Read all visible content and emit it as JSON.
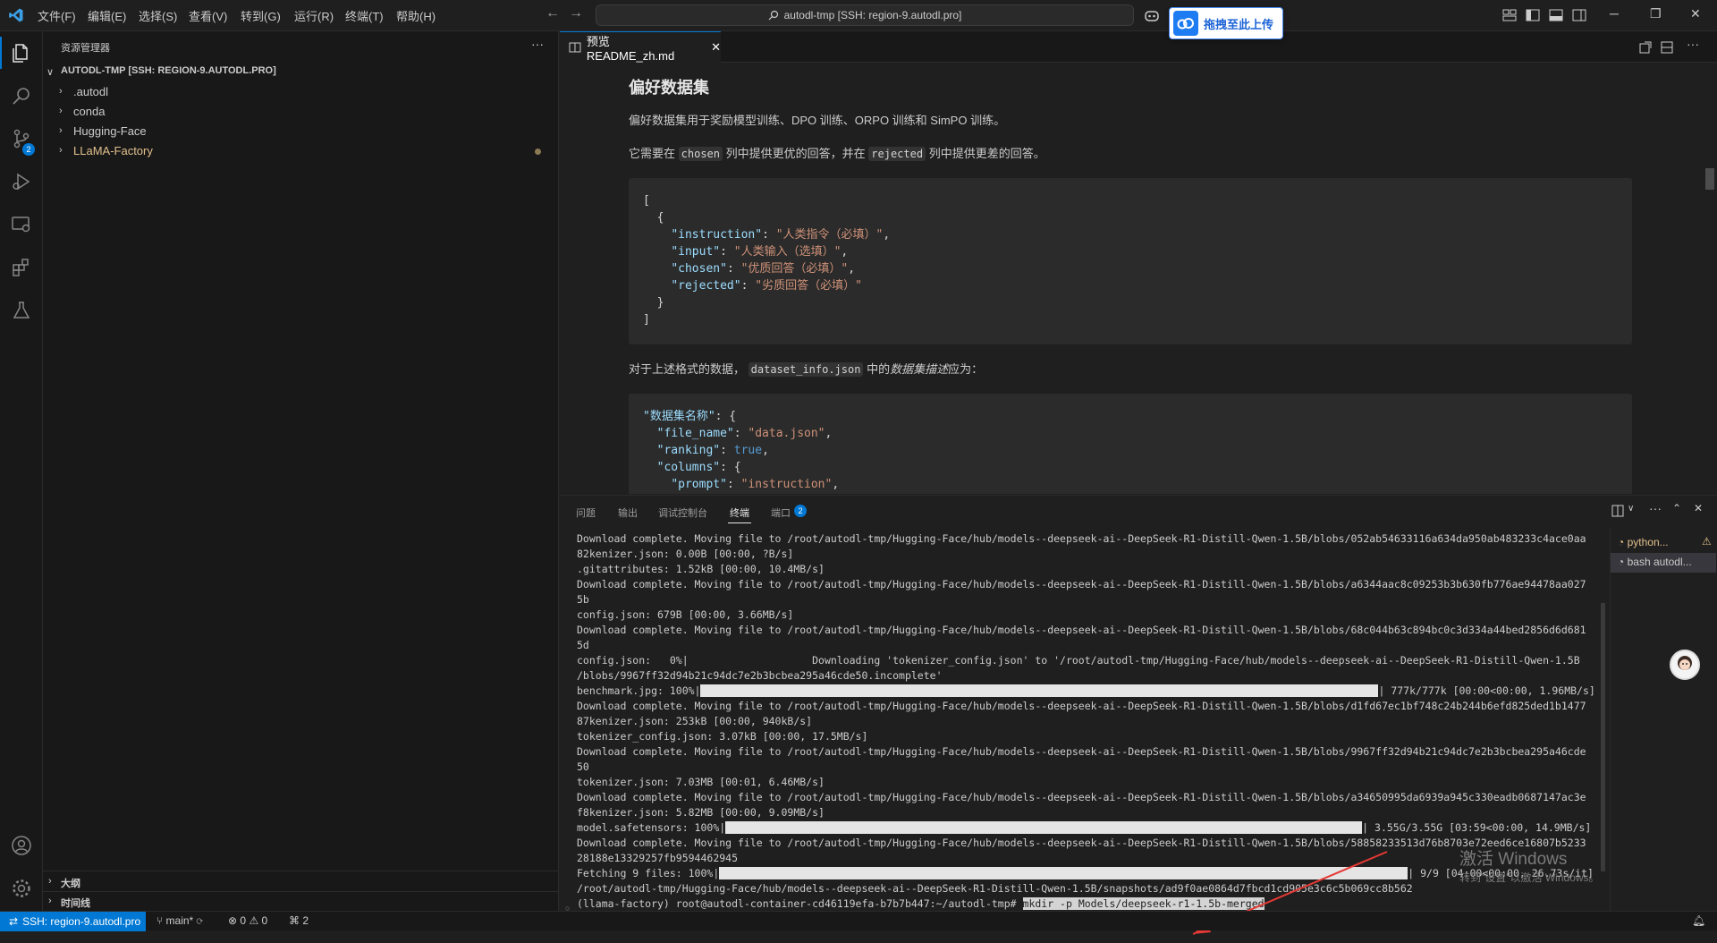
{
  "titlebar": {
    "menus": [
      "文件(F)",
      "编辑(E)",
      "选择(S)",
      "查看(V)",
      "转到(G)",
      "运行(R)",
      "终端(T)",
      "帮助(H)"
    ],
    "command_center": "autodl-tmp [SSH: region-9.autodl.pro]",
    "upload_button": "拖拽至此上传"
  },
  "sidebar": {
    "title": "资源管理器",
    "root": "AUTODL-TMP [SSH: REGION-9.AUTODL.PRO]",
    "items": [
      {
        "label": ".autodl",
        "color": "#cccccc"
      },
      {
        "label": "conda",
        "color": "#cccccc"
      },
      {
        "label": "Hugging-Face",
        "color": "#cccccc"
      },
      {
        "label": "LLaMA-Factory",
        "color": "#e2c08d"
      }
    ],
    "outline": "大纲",
    "timeline": "时间线"
  },
  "editor": {
    "tab_label": "预览 README_zh.md",
    "heading": "偏好数据集",
    "p1": "偏好数据集用于奖励模型训练、DPO 训练、ORPO 训练和 SimPO 训练。",
    "p2_a": "它需要在",
    "p2_code1": "chosen",
    "p2_b": "列中提供更优的回答，并在",
    "p2_code2": "rejected",
    "p2_c": "列中提供更差的回答。",
    "code1": {
      "open": "[",
      "brace_open": "  {",
      "l1_key": "\"instruction\"",
      "l1_val": "\"人类指令（必填）\"",
      "l2_key": "\"input\"",
      "l2_val": "\"人类输入（选填）\"",
      "l3_key": "\"chosen\"",
      "l3_val": "\"优质回答（必填）\"",
      "l4_key": "\"rejected\"",
      "l4_val": "\"劣质回答（必填）\"",
      "brace_close": "  }",
      "close": "]"
    },
    "p3_a": "对于上述格式的数据，",
    "p3_code": "dataset_info.json",
    "p3_b": "中的",
    "p3_em": "数据集描述",
    "p3_c": "应为：",
    "code2": {
      "l0_key": "\"数据集名称\"",
      "l1_key": "\"file_name\"",
      "l1_val": "\"data.json\"",
      "l2_key": "\"ranking\"",
      "l2_val": "true",
      "l3_key": "\"columns\"",
      "l4_key": "\"prompt\"",
      "l4_val": "\"instruction\""
    }
  },
  "panel": {
    "tabs": [
      "问题",
      "输出",
      "调试控制台",
      "终端",
      "端口"
    ],
    "ports_badge": "2",
    "terminal_lines": [
      "Download complete. Moving file to /root/autodl-tmp/Hugging-Face/hub/models--deepseek-ai--DeepSeek-R1-Distill-Qwen-1.5B/blobs/052ab54633116a634da950ab483233c4ace0aa",
      "82kenizer.json: 0.00B [00:00, ?B/s]",
      ".gitattributes: 1.52kB [00:00, 10.4MB/s]",
      "Download complete. Moving file to /root/autodl-tmp/Hugging-Face/hub/models--deepseek-ai--DeepSeek-R1-Distill-Qwen-1.5B/blobs/a6344aac8c09253b3b630fb776ae94478aa027",
      "5b",
      "config.json: 679B [00:00, 3.66MB/s]",
      "Download complete. Moving file to /root/autodl-tmp/Hugging-Face/hub/models--deepseek-ai--DeepSeek-R1-Distill-Qwen-1.5B/blobs/68c044b63c894bc0c3d334a44bed2856d6d681",
      "5d",
      "config.json:   0%|                    Downloading 'tokenizer_config.json' to '/root/autodl-tmp/Hugging-Face/hub/models--deepseek-ai--DeepSeek-R1-Distill-Qwen-1.5B",
      "/blobs/9967ff32d94b21c94dc7e2b3bcbea295a46cde50.incomplete'"
    ],
    "bench_label": "benchmark.jpg: 100%|",
    "bench_tail": "| 777k/777k [00:00<00:00, 1.96MB/s]",
    "terminal_lines2": [
      "Download complete. Moving file to /root/autodl-tmp/Hugging-Face/hub/models--deepseek-ai--DeepSeek-R1-Distill-Qwen-1.5B/blobs/d1fd67ec1bf748c24b244b6efd825ded1b1477",
      "87kenizer.json: 253kB [00:00, 940kB/s]",
      "tokenizer_config.json: 3.07kB [00:00, 17.5MB/s]",
      "Download complete. Moving file to /root/autodl-tmp/Hugging-Face/hub/models--deepseek-ai--DeepSeek-R1-Distill-Qwen-1.5B/blobs/9967ff32d94b21c94dc7e2b3bcbea295a46cde",
      "50",
      "tokenizer.json: 7.03MB [00:01, 6.46MB/s]",
      "Download complete. Moving file to /root/autodl-tmp/Hugging-Face/hub/models--deepseek-ai--DeepSeek-R1-Distill-Qwen-1.5B/blobs/a34650995da6939a945c330eadb0687147ac3e",
      "f8kenizer.json: 5.82MB [00:00, 9.09MB/s]"
    ],
    "model_label": "model.safetensors: 100%|",
    "model_tail": "| 3.55G/3.55G [03:59<00:00, 14.9MB/s]",
    "terminal_lines3": [
      "Download complete. Moving file to /root/autodl-tmp/Hugging-Face/hub/models--deepseek-ai--DeepSeek-R1-Distill-Qwen-1.5B/blobs/58858233513d76b8703e72eed6ce16807b5233",
      "28188e13329257fb9594462945"
    ],
    "fetch_label": "Fetching 9 files: 100%|",
    "fetch_tail": "| 9/9 [04:00<00:00, 26.73s/it]",
    "snapshot_line": "/root/autodl-tmp/Hugging-Face/hub/models--deepseek-ai--DeepSeek-R1-Distill-Qwen-1.5B/snapshots/ad9f0ae0864d7fbcd1cd905e3c6c5b069cc8b562",
    "prompt": "(llama-factory) root@autodl-container-cd46119efa-b7b7b447:~/autodl-tmp#",
    "command": "mkdir -p Models/deepseek-r1-1.5b-merged",
    "terminals": [
      "python...",
      "bash  autodl..."
    ]
  },
  "watermark": {
    "line1": "激活 Windows",
    "line2": "转到\"设置\"以激活 Windows。"
  },
  "statusbar": {
    "remote": "SSH: region-9.autodl.pro",
    "branch": "main*",
    "errors": "0",
    "warnings": "0",
    "ports": "2"
  },
  "colors": {
    "accent": "#0078d4",
    "background": "#1f1f1f",
    "modified": "#e2c08d"
  }
}
